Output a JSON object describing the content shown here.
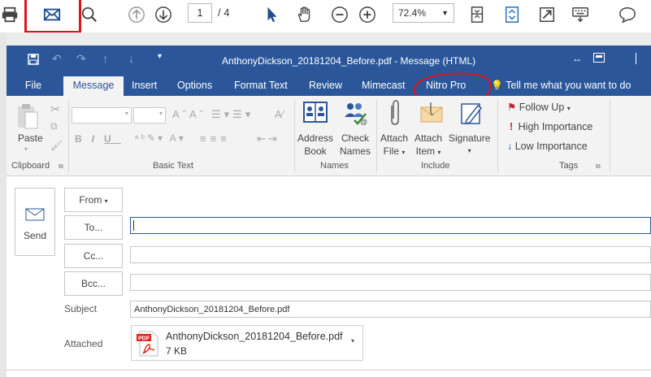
{
  "pdf_toolbar": {
    "page_current": "1",
    "page_total": "/ 4",
    "zoom": "72.4%",
    "icons": [
      "print-icon",
      "mail-icon",
      "search-icon",
      "prev-page-icon",
      "next-page-icon",
      "select-pointer-icon",
      "hand-tool-icon",
      "zoom-out-icon",
      "zoom-in-icon",
      "fit-page-icon",
      "rotate-icon",
      "fullscreen-icon",
      "keyboard-icon",
      "comment-icon"
    ]
  },
  "window": {
    "title": "AnthonyDickson_20181204_Before.pdf - Message (HTML)"
  },
  "tabs": [
    {
      "label": "File"
    },
    {
      "label": "Message"
    },
    {
      "label": "Insert"
    },
    {
      "label": "Options"
    },
    {
      "label": "Format Text"
    },
    {
      "label": "Review"
    },
    {
      "label": "Mimecast"
    },
    {
      "label": "Nitro Pro"
    },
    {
      "label": "Tell me what you want to do"
    }
  ],
  "ribbon": {
    "clipboard": {
      "paste": "Paste",
      "group": "Clipboard"
    },
    "basic_text": {
      "group": "Basic Text"
    },
    "names": {
      "address_book_1": "Address",
      "address_book_2": "Book",
      "check_names_1": "Check",
      "check_names_2": "Names",
      "group": "Names"
    },
    "include": {
      "attach_file_1": "Attach",
      "attach_file_2": "File",
      "attach_item_1": "Attach",
      "attach_item_2": "Item",
      "signature": "Signature",
      "group": "Include"
    },
    "tags": {
      "follow_up": "Follow Up",
      "high": "High Importance",
      "low": "Low Importance",
      "group": "Tags"
    }
  },
  "message": {
    "send": "Send",
    "from": "From",
    "to": "To...",
    "cc": "Cc...",
    "bcc": "Bcc...",
    "subject_label": "Subject",
    "subject_value": "AnthonyDickson_20181204_Before.pdf",
    "attached_label": "Attached",
    "attachment_name": "AnthonyDickson_20181204_Before.pdf",
    "attachment_size": "7 KB",
    "attachment_type": "PDF"
  },
  "colors": {
    "outlook_blue": "#2b579a",
    "annotation_red": "#e0121c",
    "pdf_red": "#e2231a"
  }
}
